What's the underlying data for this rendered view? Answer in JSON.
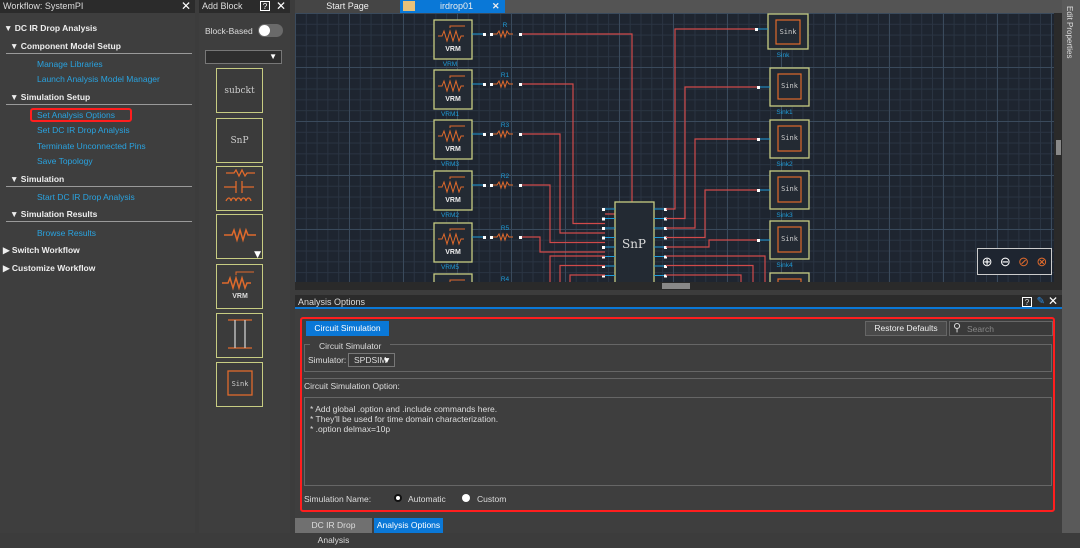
{
  "workflow": {
    "title": "Workflow: SystemPI",
    "items": [
      {
        "label": "DC IR Drop Analysis",
        "type": "h0"
      },
      {
        "label": "Component Model Setup",
        "type": "h1"
      },
      {
        "label": "Manage Libraries",
        "type": "link"
      },
      {
        "label": "Launch Analysis Model Manager",
        "type": "link"
      },
      {
        "label": "Simulation Setup",
        "type": "h1"
      },
      {
        "label": "Set Analysis Options",
        "type": "link",
        "highlighted": true
      },
      {
        "label": "Set DC IR Drop Analysis",
        "type": "link"
      },
      {
        "label": "Terminate Unconnected Pins",
        "type": "link"
      },
      {
        "label": "Save Topology",
        "type": "link"
      },
      {
        "label": "Simulation",
        "type": "h1"
      },
      {
        "label": "Start DC IR Drop Analysis",
        "type": "link"
      },
      {
        "label": "Simulation Results",
        "type": "h1"
      },
      {
        "label": "Browse Results",
        "type": "link"
      },
      {
        "label": "Switch Workflow",
        "type": "collapsed"
      },
      {
        "label": "Customize Workflow",
        "type": "collapsed"
      }
    ]
  },
  "add_block": {
    "title": "Add Block",
    "toggle_label": "Block-Based",
    "toggle_on": false,
    "dropdown_value": "",
    "blocks": [
      {
        "icon": "subckt-icon",
        "label": "subckt"
      },
      {
        "icon": "snp-icon",
        "label": "SnP"
      },
      {
        "icon": "rlc-icon"
      },
      {
        "icon": "resistor-icon"
      },
      {
        "icon": "vrm-icon",
        "label": "VRM"
      },
      {
        "icon": "transmission-line-icon"
      },
      {
        "icon": "sink-icon",
        "label": "Sink"
      }
    ]
  },
  "doc_tabs": [
    {
      "label": "Start Page",
      "active": false
    },
    {
      "label": "irdrop01",
      "active": true
    }
  ],
  "schematic": {
    "vrms": [
      {
        "title": "VRM",
        "name": "VRM"
      },
      {
        "title": "VRM",
        "name": "VRM1"
      },
      {
        "title": "VRM",
        "name": "VRM3"
      },
      {
        "title": "VRM",
        "name": "VRM2"
      },
      {
        "title": "VRM",
        "name": "VRM5"
      }
    ],
    "resistors": [
      "R",
      "R1",
      "R3",
      "R2",
      "R5",
      "R4"
    ],
    "snp_label": "SnP",
    "sinks": [
      {
        "title": "Sink",
        "name": "Sink"
      },
      {
        "title": "Sink",
        "name": "Sink1"
      },
      {
        "title": "Sink",
        "name": "Sink2"
      },
      {
        "title": "Sink",
        "name": "Sink3"
      },
      {
        "title": "Sink",
        "name": "Sink4"
      }
    ],
    "zoom_tools": [
      "zoom-in-icon",
      "zoom-out-icon",
      "zoom-fit-icon",
      "zoom-selection-icon"
    ]
  },
  "edit_properties": "Edit Properties",
  "analysis_options": {
    "title": "Analysis Options",
    "tab": "Circuit Simulation",
    "restore_defaults": "Restore Defaults",
    "search_placeholder": "Search",
    "group_title": "Circuit Simulator",
    "simulator_label": "Simulator:",
    "simulator_value": "SPDSIM",
    "option_label": "Circuit Simulation Option:",
    "option_lines": [
      "* Add global .option and .include commands here.",
      "* They'll be used for time domain characterization.",
      "* .option delmax=10p"
    ],
    "sim_name_label": "Simulation Name:",
    "radio_automatic": "Automatic",
    "radio_custom": "Custom",
    "selected": "Automatic"
  },
  "bottom_tabs": [
    {
      "label": "DC IR Drop Analysis",
      "active": false
    },
    {
      "label": "Analysis Options",
      "active": true
    }
  ],
  "colors": {
    "accent": "#0a78d7",
    "link": "#29a3e0",
    "highlight": "#ff1e1e",
    "wire": "#d04a4a",
    "block_border": "#c7cc82",
    "component": "#e06a2c"
  }
}
